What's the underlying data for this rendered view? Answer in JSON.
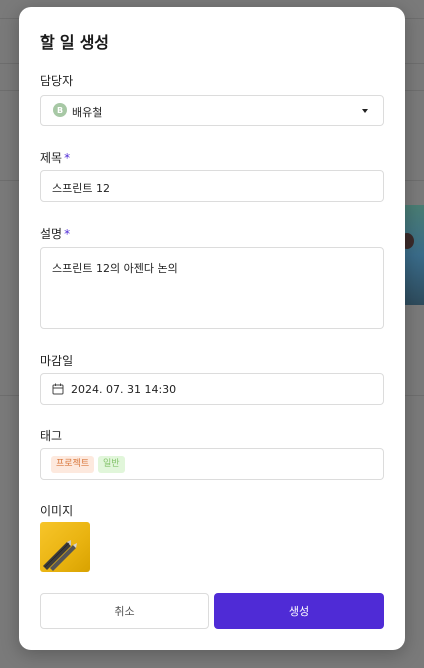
{
  "modal": {
    "title": "할 일 생성"
  },
  "assignee": {
    "label": "담당자",
    "avatar_initial": "B",
    "value": "배유철"
  },
  "task_title": {
    "label": "제목",
    "required_mark": "*",
    "value": "스프린트 12"
  },
  "description": {
    "label": "설명",
    "required_mark": "*",
    "value": "스프린트 12의 아젠다 논의"
  },
  "due_date": {
    "label": "마감일",
    "value": "2024. 07. 31 14:30",
    "icon": "calendar-icon"
  },
  "tags": {
    "label": "태그",
    "items": [
      {
        "label": "프로젝트",
        "color": "#d9773c",
        "bg": "#fde9de"
      },
      {
        "label": "일반",
        "color": "#86c46d",
        "bg": "#e1f6da"
      }
    ]
  },
  "image": {
    "label": "이미지",
    "icon": "pencils-thumbnail"
  },
  "buttons": {
    "cancel": "취소",
    "create": "생성"
  },
  "colors": {
    "accent": "#4f2bd6",
    "avatar_bg": "#a7c8a5"
  }
}
